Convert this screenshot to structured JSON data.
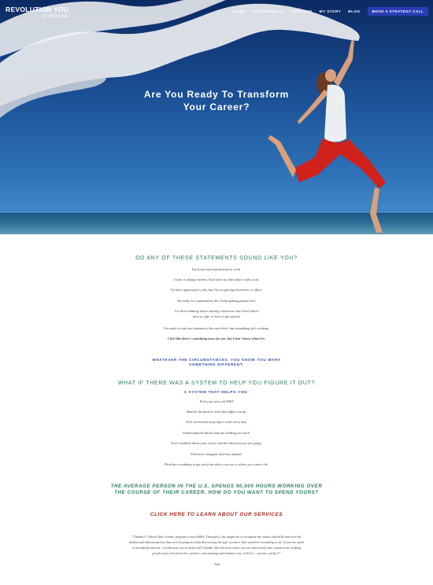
{
  "brand": {
    "logo_main": "REVOLUTION YOU",
    "logo_sub": "COACHING"
  },
  "nav": {
    "items": [
      "HOME",
      "TESTIMONIALS",
      "SERVICES",
      "MY STORY",
      "BLOG"
    ],
    "cta": "BOOK A STRATEGY CALL"
  },
  "hero": {
    "title_line1": "Are You Ready To Transform",
    "title_line2": "Your Career?"
  },
  "section1": {
    "heading": "DO ANY OF THESE STATEMENTS SOUND LIKE YOU?",
    "statements": [
      "I'm bored and unmotivated at work.",
      "I want to change careers, but I have no idea what I want to do.",
      "I'm been applying for jobs, but I'm not getting interviews or offers.",
      "I'm ready for a promotion, but I keep getting passed over.",
      "I've been thinking about starting a business, but I don't know",
      "what to offer or how to get started.",
      "I'm ready to take my business to the next level, but something isn't working.",
      "I feel like there's something more for me, but I don't know what it is."
    ]
  },
  "section2": {
    "line1": "WHATEVER THE CIRCUMSTANCES, YOU KNOW YOU WANT",
    "line2": "SOMETHING DIFFERENT."
  },
  "section3": {
    "heading": "WHAT IF THERE WAS A SYSTEM TO HELP YOU FIGURE IT OUT?",
    "subheading": "A SYSTEM THAT HELPS YOU:",
    "items": [
      "Find your next job FAST",
      "Identify the kind of work that lights you up.",
      "Feel excited about going to work every day.",
      "Understand the blocks that are holding you back.",
      "Feel confident about your career and the direction you are going.",
      "Feel more energetic and less drained.",
      "Develop a roadmap to get you from where you are to where you want to be."
    ]
  },
  "section4": {
    "line1": "THE AVERAGE PERSON IN THE U.S. SPENDS 90,000 HOURS WORKING OVER",
    "line2": "THE COURSE OF THEIR CAREER. HOW DO YOU WANT TO SPEND YOURS?",
    "link": "CLICK HERE TO LEARN ABOUT OUR SERVICES"
  },
  "testimonial": {
    "line1": "\"Claudia's 'Unlock Your Genius' program is incredible! Through it, she taught me to recognize my values and skills and even the",
    "line2": "doubts and misconceptions that were keeping me from discovering the type of career that would be rewarding to me. If you are stuck",
    "line3": "or feeling burned out, I would urge you to work with Claudia. She has been where you are and clearly has a passion for helping",
    "line4": "people move forward in her positive, encouraging and intuitive way. Call her – you are worth it!\"",
    "author": "- Julie"
  },
  "colors": {
    "accent_green": "#2e7d5b",
    "accent_blue": "#2a4c9a",
    "cta_blue": "#2a3cb5",
    "link_red": "#a3251c"
  }
}
